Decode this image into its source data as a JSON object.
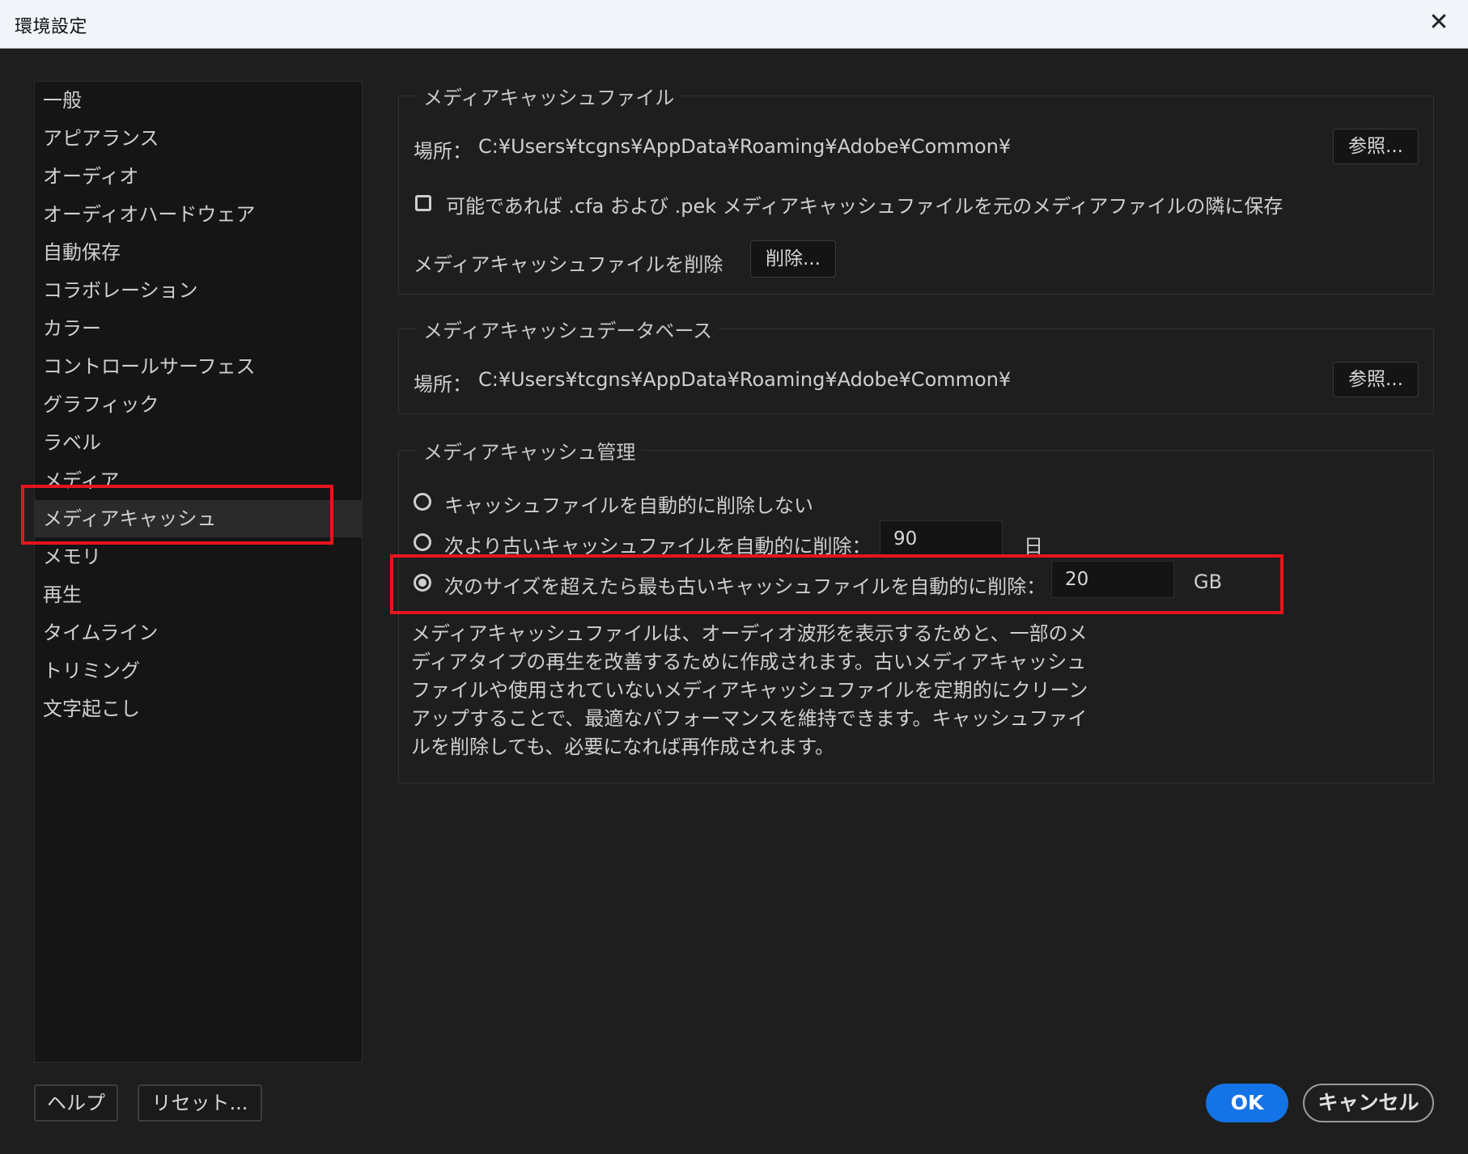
{
  "window": {
    "title": "環境設定"
  },
  "sidebar": {
    "items": [
      {
        "label": "一般"
      },
      {
        "label": "アピアランス"
      },
      {
        "label": "オーディオ"
      },
      {
        "label": "オーディオハードウェア"
      },
      {
        "label": "自動保存"
      },
      {
        "label": "コラボレーション"
      },
      {
        "label": "カラー"
      },
      {
        "label": "コントロールサーフェス"
      },
      {
        "label": "グラフィック"
      },
      {
        "label": "ラベル"
      },
      {
        "label": "メディア"
      },
      {
        "label": "メディアキャッシュ"
      },
      {
        "label": "メモリ"
      },
      {
        "label": "再生"
      },
      {
        "label": "タイムライン"
      },
      {
        "label": "トリミング"
      },
      {
        "label": "文字起こし"
      }
    ],
    "selected": "メディアキャッシュ"
  },
  "cache_files": {
    "legend": "メディアキャッシュファイル",
    "location_label": "場所：",
    "location_path": "C:¥Users¥tcgns¥AppData¥Roaming¥Adobe¥Common¥",
    "browse_label": "参照...",
    "save_next_label": "可能であれば .cfa および .pek メディアキャッシュファイルを元のメディアファイルの隣に保存",
    "save_next_checked": false,
    "delete_label": "メディアキャッシュファイルを削除",
    "delete_button": "削除..."
  },
  "cache_db": {
    "legend": "メディアキャッシュデータベース",
    "location_label": "場所：",
    "location_path": "C:¥Users¥tcgns¥AppData¥Roaming¥Adobe¥Common¥",
    "browse_label": "参照..."
  },
  "cache_mgmt": {
    "legend": "メディアキャッシュ管理",
    "option_never": "キャッシュファイルを自動的に削除しない",
    "option_older": "次より古いキャッシュファイルを自動的に削除：",
    "older_value": "90",
    "older_unit": "日",
    "option_size": "次のサイズを超えたら最も古いキャッシュファイルを自動的に削除：",
    "size_value": "20",
    "size_unit": "GB",
    "selected_option": "option_size",
    "description": "メディアキャッシュファイルは、オーディオ波形を表示するためと、一部のメディアタイプの再生を改善するために作成されます。古いメディアキャッシュファイルや使用されていないメディアキャッシュファイルを定期的にクリーンアップすることで、最適なパフォーマンスを維持できます。キャッシュファイルを削除しても、必要になれば再作成されます。"
  },
  "footer": {
    "help": "ヘルプ",
    "reset": "リセット...",
    "ok": "OK",
    "cancel": "キャンセル"
  },
  "colors": {
    "accent": "#1473e6",
    "highlight": "#e8141c",
    "background": "#1e1e1e"
  }
}
